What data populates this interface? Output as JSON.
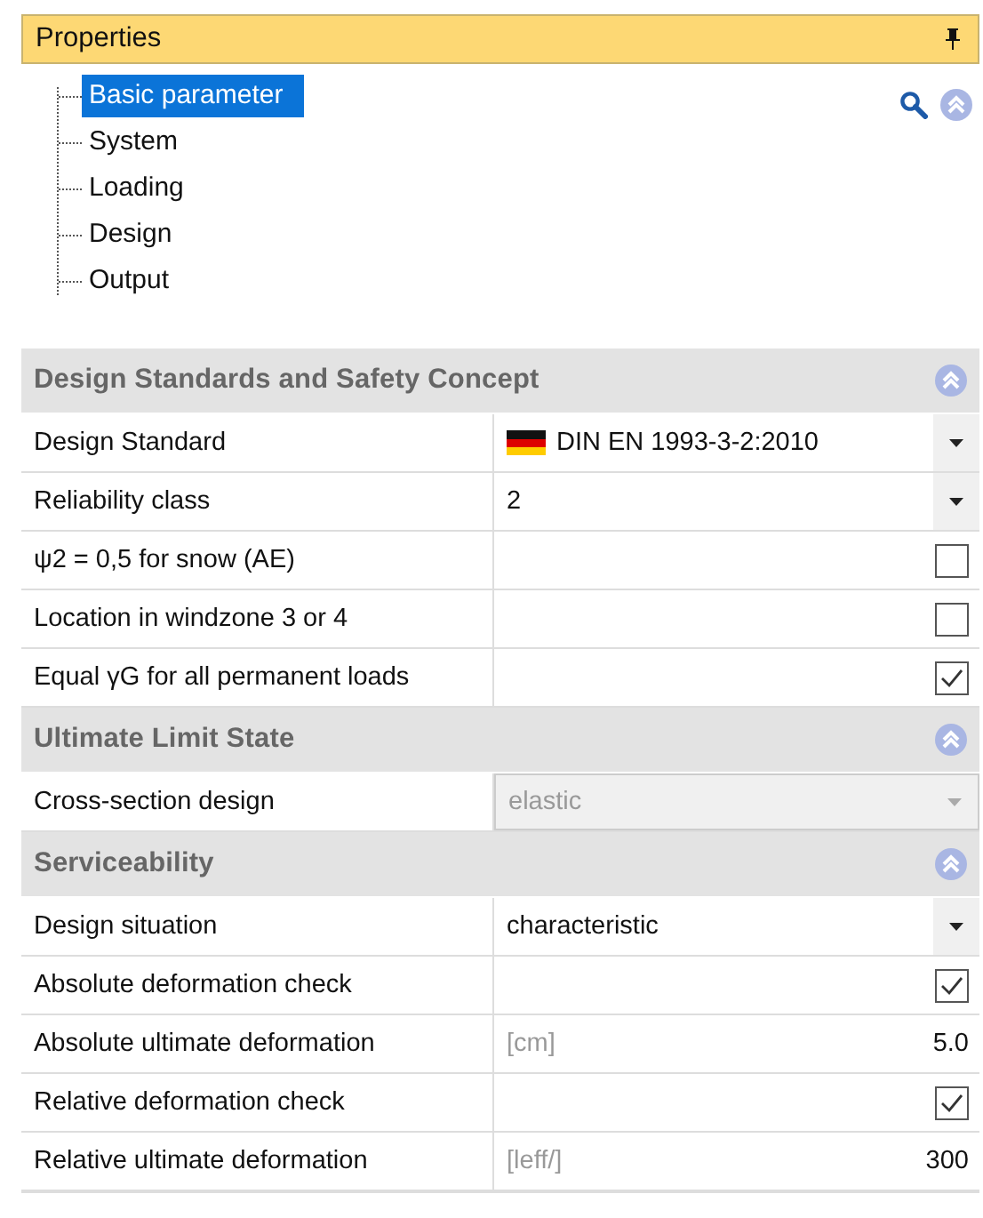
{
  "panel": {
    "title": "Properties",
    "pinned": true
  },
  "tree": {
    "items": [
      {
        "label": "Basic parameter",
        "selected": true
      },
      {
        "label": "System",
        "selected": false
      },
      {
        "label": "Loading",
        "selected": false
      },
      {
        "label": "Design",
        "selected": false
      },
      {
        "label": "Output",
        "selected": false
      }
    ]
  },
  "sections": [
    {
      "title": "Design Standards and Safety Concept",
      "expanded": true,
      "rows": [
        {
          "kind": "dropdown",
          "label": "Design Standard",
          "value": "DIN EN 1993-3-2:2010",
          "flag": true,
          "disabled": false
        },
        {
          "kind": "dropdown",
          "label": "Reliability class",
          "value": "2",
          "disabled": false
        },
        {
          "kind": "checkbox",
          "label": "ψ2 = 0,5 for snow (AE)",
          "checked": false
        },
        {
          "kind": "checkbox",
          "label": "Location in windzone 3 or 4",
          "checked": false
        },
        {
          "kind": "checkbox",
          "label": "Equal γG for all permanent loads",
          "checked": true
        }
      ]
    },
    {
      "title": "Ultimate Limit State",
      "expanded": true,
      "rows": [
        {
          "kind": "dropdown",
          "label": "Cross-section design",
          "value": "elastic",
          "disabled": true
        }
      ]
    },
    {
      "title": "Serviceability",
      "expanded": true,
      "rows": [
        {
          "kind": "dropdown",
          "label": "Design situation",
          "value": "characteristic",
          "disabled": false
        },
        {
          "kind": "checkbox",
          "label": "Absolute deformation check",
          "checked": true
        },
        {
          "kind": "number",
          "label": "Absolute ultimate deformation",
          "unit": "[cm]",
          "value": "5.0"
        },
        {
          "kind": "checkbox",
          "label": "Relative deformation check",
          "checked": true
        },
        {
          "kind": "number",
          "label": "Relative ultimate deformation",
          "unit": "[leff/]",
          "value": "300"
        }
      ]
    }
  ]
}
